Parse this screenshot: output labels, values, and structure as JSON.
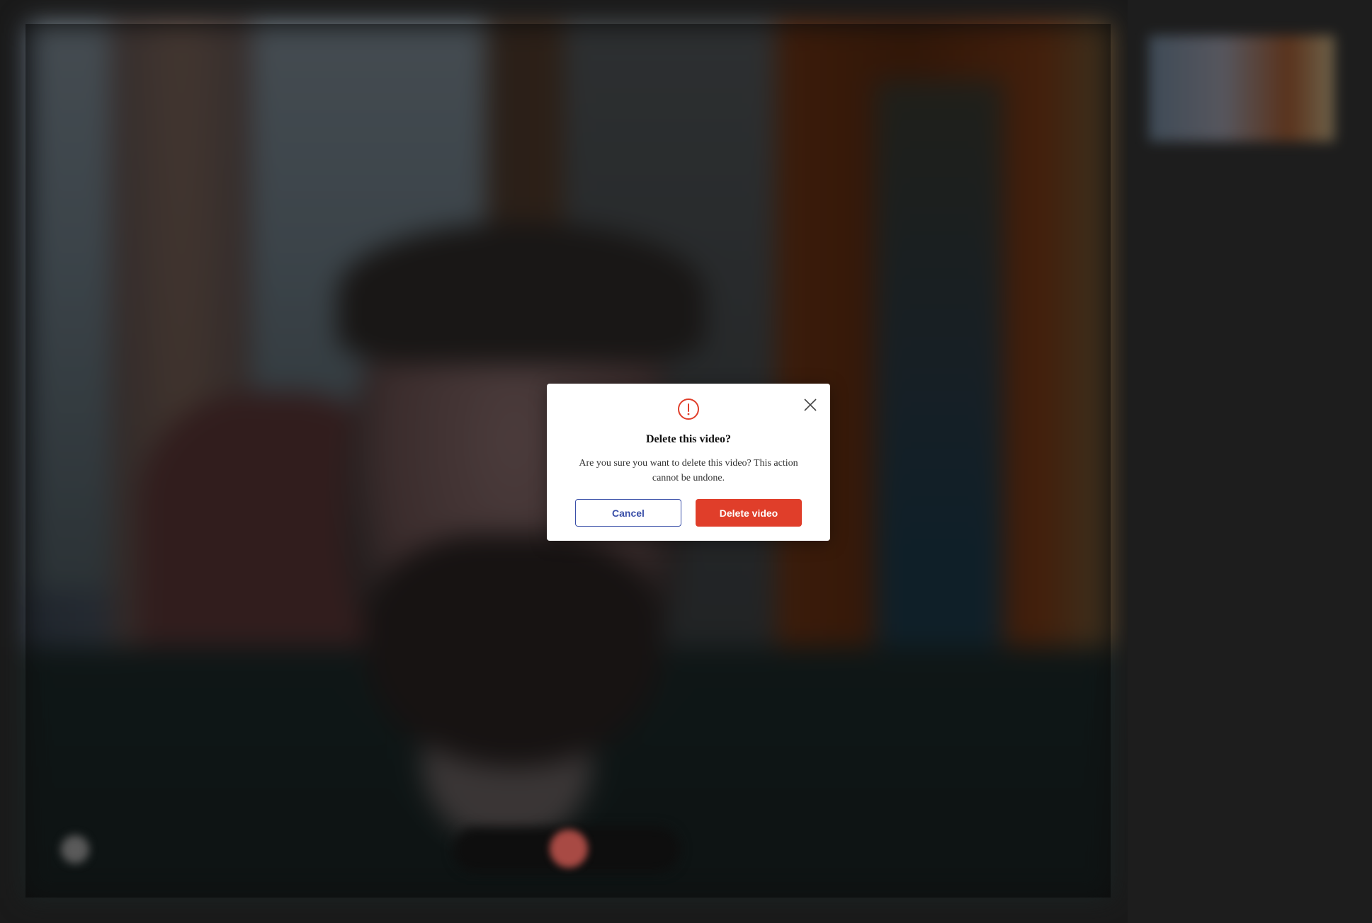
{
  "modal": {
    "title": "Delete this video?",
    "message": "Are you sure you want to delete this video? This action cannot be undone.",
    "cancel_label": "Cancel",
    "delete_label": "Delete video",
    "icon": "exclamation-circle-icon",
    "close_icon": "close-icon"
  },
  "colors": {
    "danger": "#e03e2a",
    "primary_outline": "#3a4fa8",
    "backdrop": "#121212",
    "modal_bg": "#ffffff"
  }
}
